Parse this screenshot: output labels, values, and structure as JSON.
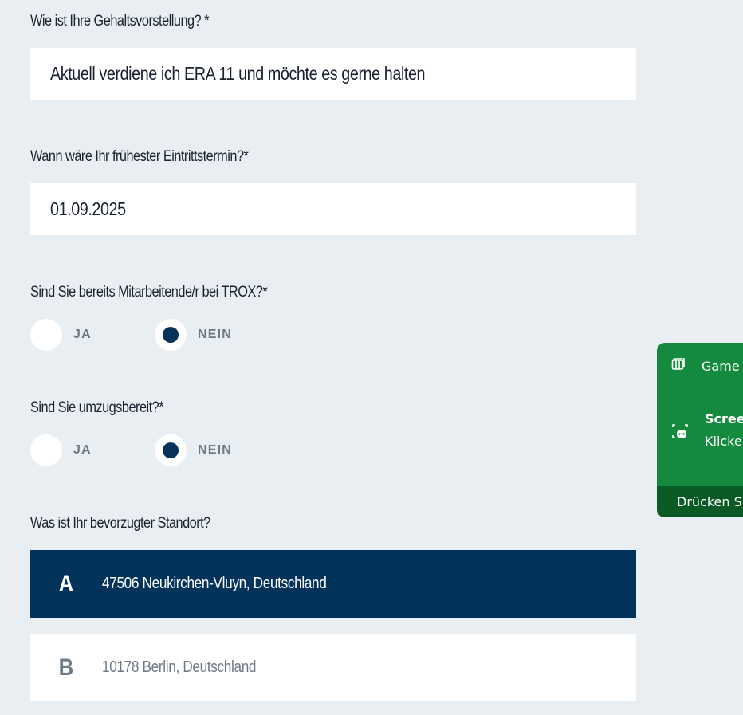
{
  "salary": {
    "label": "Wie ist Ihre Gehaltsvorstellung? *",
    "value": "Aktuell verdiene ich ERA 11 und möchte es gerne halten"
  },
  "start_date": {
    "label": "Wann wäre Ihr frühester Eintrittstermin?*",
    "value": "01.09.2025"
  },
  "employee": {
    "label": "Sind Sie bereits Mitarbeitende/r bei TROX?*",
    "options": [
      "JA",
      "NEIN"
    ],
    "selected": "NEIN"
  },
  "relocate": {
    "label": "Sind Sie umzugsbereit?*",
    "options": [
      "JA",
      "NEIN"
    ],
    "selected": "NEIN"
  },
  "location": {
    "label": "Was ist Ihr bevorzugter Standort?",
    "options": [
      {
        "letter": "A",
        "text": "47506 Neukirchen-Vluyn, Deutschland",
        "selected": true
      },
      {
        "letter": "B",
        "text": "10178 Berlin, Deutschland",
        "selected": false
      }
    ]
  },
  "toast": {
    "row1": "Game",
    "title": "Screer",
    "subtitle": "Klicker",
    "footer": "Drücken Sie",
    "row1_icon": "widget-icon",
    "row2_icon": "screenshot-gamebar-icon"
  },
  "colors": {
    "background": "#e9eef2",
    "accent_navy": "#03325a",
    "toast_green": "#138a3d"
  }
}
